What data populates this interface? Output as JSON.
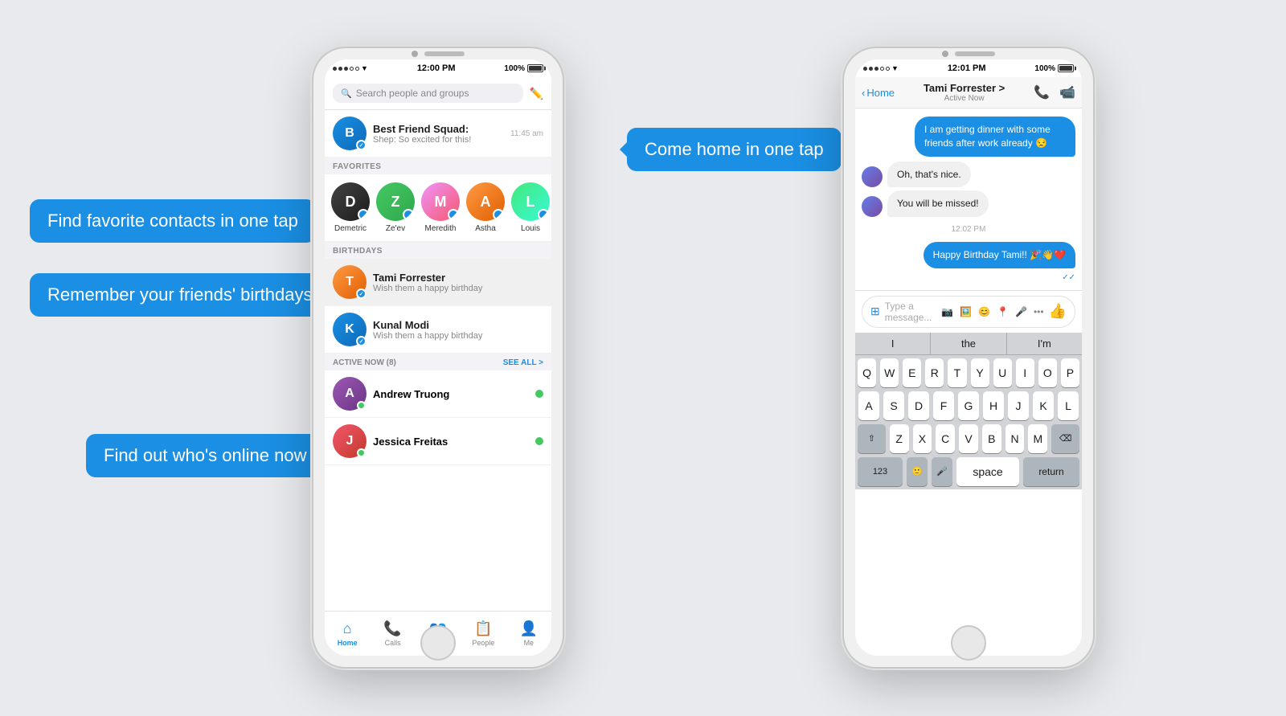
{
  "callouts": {
    "favorites": "Find favorite contacts in one tap",
    "birthdays": "Remember your friends' birthdays",
    "online": "Find out who's online now",
    "home": "Come home in one tap"
  },
  "phone_left": {
    "status_bar": {
      "time": "12:00 PM",
      "battery": "100%"
    },
    "search": {
      "placeholder": "Search people and groups"
    },
    "chat_item": {
      "name": "Best Friend Squad:",
      "preview": "Shep: So excited for this!",
      "time": "11:45 am"
    },
    "section_favorites": "FAVORITES",
    "favorites": [
      {
        "name": "Demetric",
        "initials": "D"
      },
      {
        "name": "Ze'ev",
        "initials": "Z"
      },
      {
        "name": "Meredith",
        "initials": "M"
      },
      {
        "name": "Astha",
        "initials": "A"
      },
      {
        "name": "Louis",
        "initials": "L"
      }
    ],
    "section_birthdays": "BIRTHDAYS",
    "birthdays": [
      {
        "name": "Tami Forrester",
        "sub": "Wish them a happy birthday",
        "selected": true
      },
      {
        "name": "Kunal Modi",
        "sub": "Wish them a happy birthday",
        "selected": false
      }
    ],
    "section_active": "ACTIVE NOW (8)",
    "see_all": "SEE ALL >",
    "active": [
      {
        "name": "Andrew Truong"
      },
      {
        "name": "Jessica Freitas"
      }
    ],
    "tabs": [
      {
        "label": "Home",
        "active": true,
        "icon": "⌂"
      },
      {
        "label": "Calls",
        "active": false,
        "icon": "📞"
      },
      {
        "label": "Groups",
        "active": false,
        "icon": "👥"
      },
      {
        "label": "People",
        "active": false,
        "icon": "📋"
      },
      {
        "label": "Me",
        "active": false,
        "icon": "👤"
      }
    ]
  },
  "phone_right": {
    "status_bar": {
      "time": "12:01 PM",
      "battery": "100%"
    },
    "header": {
      "back": "Home",
      "name": "Tami Forrester >",
      "status": "Active Now"
    },
    "messages": [
      {
        "type": "outgoing",
        "text": "I am getting dinner with some friends after work already 😒"
      },
      {
        "type": "incoming",
        "text": "Oh, that's nice."
      },
      {
        "type": "incoming",
        "text": "You will be missed!"
      },
      {
        "type": "time",
        "text": "12:02 PM"
      },
      {
        "type": "outgoing",
        "text": "Happy Birthday Tami!! 🎉👋❤️"
      }
    ],
    "input_placeholder": "Type a message...",
    "predictive": [
      "I",
      "the",
      "I'm"
    ],
    "keyboard_rows": [
      [
        "Q",
        "W",
        "E",
        "R",
        "T",
        "Y",
        "U",
        "I",
        "O",
        "P"
      ],
      [
        "A",
        "S",
        "D",
        "F",
        "G",
        "H",
        "J",
        "K",
        "L"
      ],
      [
        "Z",
        "X",
        "C",
        "V",
        "B",
        "N",
        "M"
      ]
    ],
    "bottom_keys": [
      "123",
      "🙂",
      "🎤",
      "space",
      "return"
    ]
  }
}
